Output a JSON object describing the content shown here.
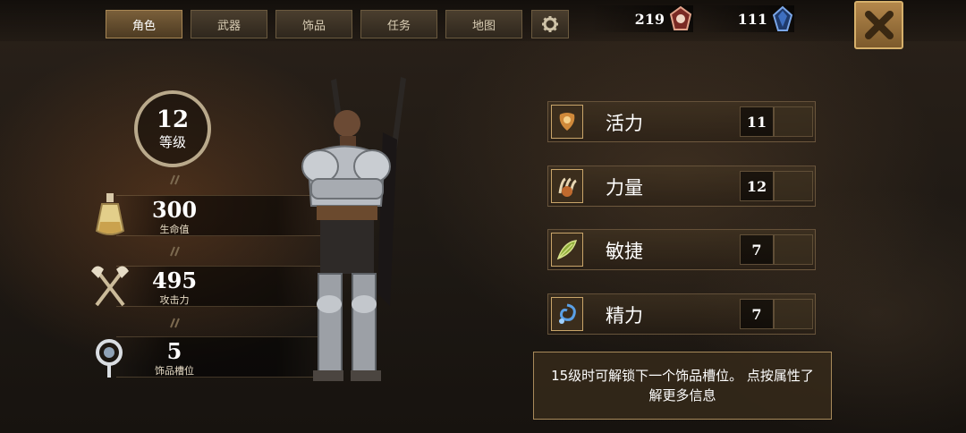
{
  "tabs": [
    {
      "label": "角色",
      "active": true
    },
    {
      "label": "武器",
      "active": false
    },
    {
      "label": "饰品",
      "active": false
    },
    {
      "label": "任务",
      "active": false
    },
    {
      "label": "地图",
      "active": false
    }
  ],
  "currencies": [
    {
      "value": "219",
      "icon": "red-gem-icon",
      "color": "#d4524a"
    },
    {
      "value": "111",
      "icon": "blue-crystal-icon",
      "color": "#4a7fd4"
    }
  ],
  "level": {
    "value": "12",
    "label": "等级"
  },
  "stats": [
    {
      "value": "300",
      "label": "生命值",
      "icon": "health-potion-icon"
    },
    {
      "value": "495",
      "label": "攻击力",
      "icon": "crossed-axes-icon"
    },
    {
      "value": "5",
      "label": "饰品槽位",
      "icon": "trinket-slot-icon"
    }
  ],
  "attributes": [
    {
      "name": "活力",
      "value": "11",
      "icon": "vitality-icon"
    },
    {
      "name": "力量",
      "value": "12",
      "icon": "strength-claw-icon"
    },
    {
      "name": "敏捷",
      "value": "7",
      "icon": "agility-feather-icon"
    },
    {
      "name": "精力",
      "value": "7",
      "icon": "energy-spiral-icon"
    }
  ],
  "info_text": "15级时可解锁下一个饰品槽位。 点按属性了解更多信息"
}
